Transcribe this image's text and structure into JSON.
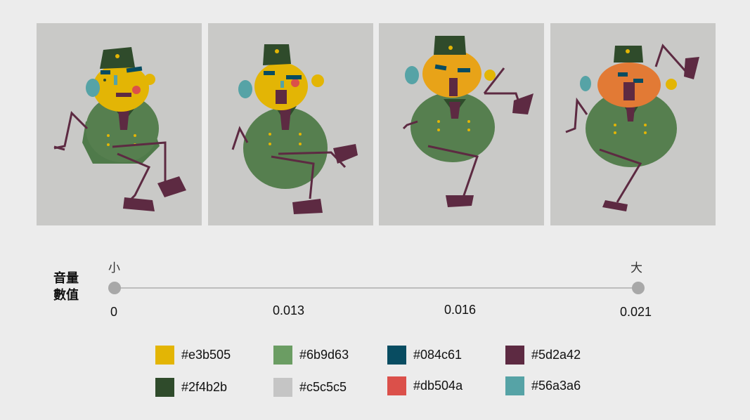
{
  "scale": {
    "label_line1": "音量",
    "label_line2": "數值",
    "end_small": "小",
    "end_large": "大",
    "ticks": [
      "0",
      "0.013",
      "0.016",
      "0.021"
    ]
  },
  "legend": [
    {
      "hex": "#e3b505",
      "label": "#e3b505"
    },
    {
      "hex": "#6b9d63",
      "label": "#6b9d63"
    },
    {
      "hex": "#084c61",
      "label": "#084c61"
    },
    {
      "hex": "#5d2a42",
      "label": "#5d2a42"
    },
    {
      "hex": "#2f4b2b",
      "label": "#2f4b2b"
    },
    {
      "hex": "#c5c5c5",
      "label": "#c5c5c5"
    },
    {
      "hex": "#db504a",
      "label": "#db504a"
    },
    {
      "hex": "#56a3a6",
      "label": "#56a3a6"
    }
  ],
  "colors": {
    "panel_bg": "#c9c9c7",
    "body_green": "#5c8a54",
    "hat": "#2f4b2b",
    "face_yellow": "#e3b505",
    "face_orange": "#e8a318",
    "face_red_orange": "#e27a35",
    "limbs": "#5d2a42",
    "ear": "#56a3a6",
    "cheek": "#db504a",
    "brow": "#084c61"
  }
}
